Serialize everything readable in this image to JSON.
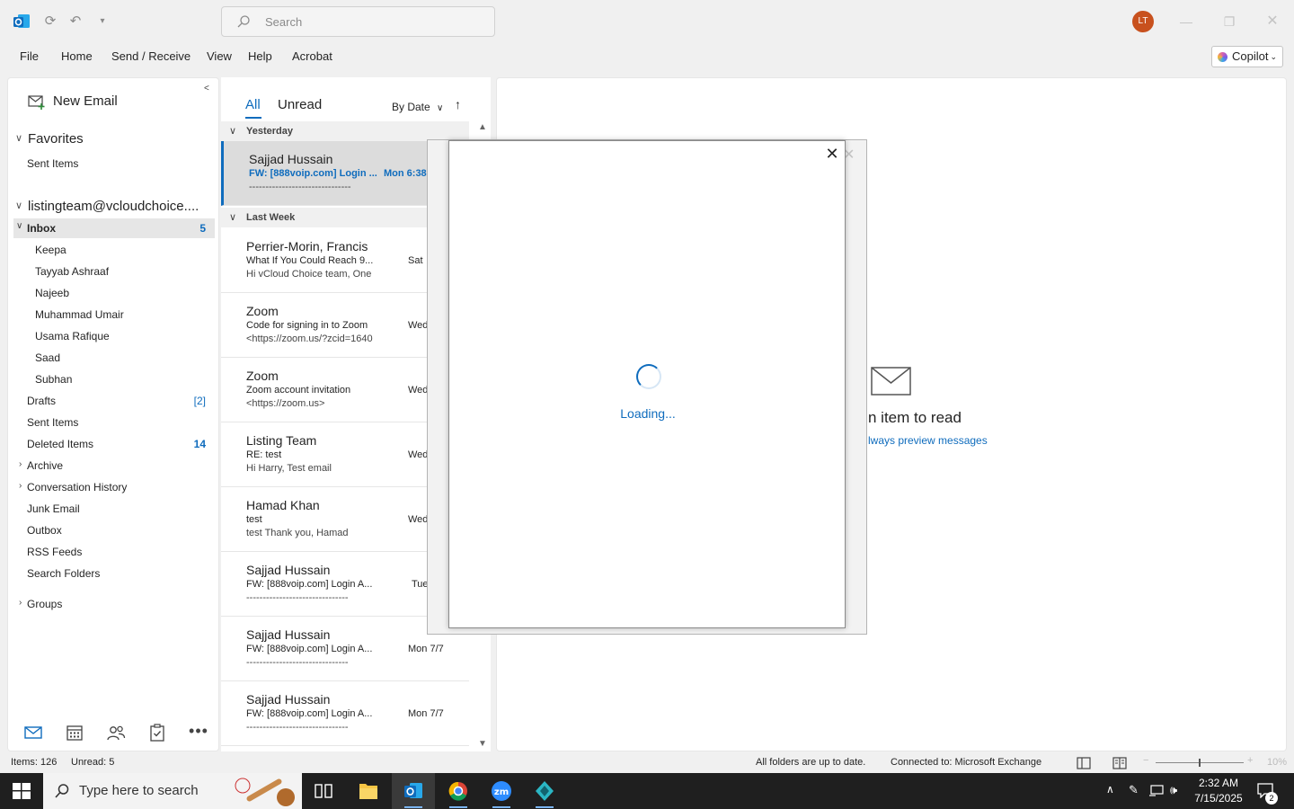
{
  "titlebar": {
    "search_placeholder": "Search",
    "avatar_initials": "LT"
  },
  "menu": {
    "items": [
      "File",
      "Home",
      "Send / Receive",
      "View",
      "Help",
      "Acrobat"
    ],
    "copilot_label": "Copilot"
  },
  "folders": {
    "new_email_label": "New Email",
    "favorites_label": "Favorites",
    "favorites_sent": "Sent Items",
    "account_label": "listingteam@vcloudchoice....",
    "inbox_label": "Inbox",
    "inbox_count": "5",
    "inbox_subfolders": [
      "Keepa",
      "Tayyab Ashraaf",
      "Najeeb",
      "Muhammad Umair",
      "Usama Rafique",
      "Saad",
      "Subhan"
    ],
    "drafts_label": "Drafts",
    "drafts_count": "[2]",
    "sent_label": "Sent Items",
    "deleted_label": "Deleted Items",
    "deleted_count": "14",
    "archive_label": "Archive",
    "conversation_label": "Conversation History",
    "junk_label": "Junk Email",
    "outbox_label": "Outbox",
    "rss_label": "RSS Feeds",
    "search_folders_label": "Search Folders",
    "groups_label": "Groups"
  },
  "message_list": {
    "tab_all": "All",
    "tab_unread": "Unread",
    "sort_label": "By Date",
    "groups": {
      "yesterday": "Yesterday",
      "last_week": "Last Week"
    },
    "messages": [
      {
        "sender": "Sajjad Hussain",
        "subject": "FW: [888voip.com] Login ...",
        "preview": "-------------------------------",
        "date": "Mon 6:38"
      },
      {
        "sender": "Perrier-Morin, Francis",
        "subject": "What If You Could Reach 9...",
        "preview": "Hi vCloud Choice team,  One",
        "date": "Sat"
      },
      {
        "sender": "Zoom",
        "subject": "Code for signing in to Zoom",
        "preview": "<https://zoom.us/?zcid=1640",
        "date": "Wed"
      },
      {
        "sender": "Zoom",
        "subject": "Zoom account invitation",
        "preview": "<https://zoom.us>",
        "date": "Wed"
      },
      {
        "sender": "Listing Team",
        "subject": "RE: test",
        "preview": "Hi Harry,   Test email",
        "date": "Wed"
      },
      {
        "sender": "Hamad Khan",
        "subject": "test",
        "preview": "test  Thank you,  Hamad",
        "date": "Wed"
      },
      {
        "sender": "Sajjad Hussain",
        "subject": "FW: [888voip.com] Login A...",
        "preview": "-------------------------------",
        "date": "Tue"
      },
      {
        "sender": "Sajjad Hussain",
        "subject": "FW: [888voip.com] Login A...",
        "preview": "-------------------------------",
        "date": "Mon 7/7"
      },
      {
        "sender": "Sajjad Hussain",
        "subject": "FW: [888voip.com] Login A...",
        "preview": "-------------------------------",
        "date": "Mon 7/7"
      }
    ]
  },
  "reading_pane": {
    "title": "n item to read",
    "link": "lways preview messages"
  },
  "dialog": {
    "loading_text": "Loading..."
  },
  "statusbar": {
    "items": "Items: 126",
    "unread": "Unread: 5",
    "sync": "All folders are up to date.",
    "connection": "Connected to: Microsoft Exchange",
    "zoom": "10%"
  },
  "taskbar": {
    "search_placeholder": "Type here to search",
    "time": "2:32 AM",
    "date": "7/15/2025",
    "notification_count": "2"
  },
  "colors": {
    "accent": "#0f6cbd",
    "avatar_bg": "#c8511e",
    "taskbar_bg": "#1f1f1f"
  }
}
